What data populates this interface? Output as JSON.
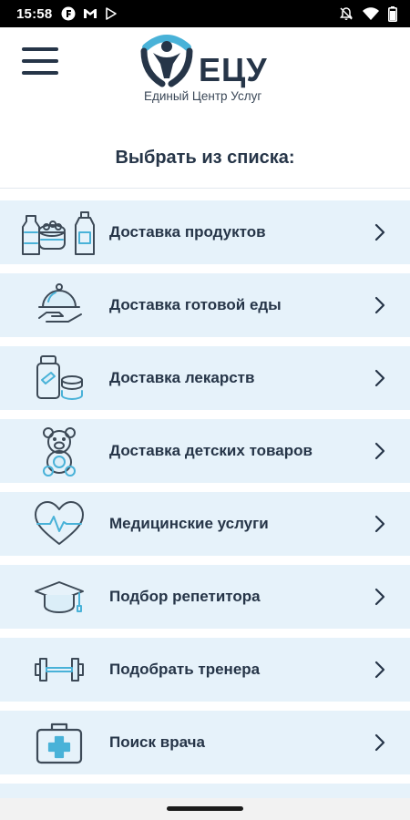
{
  "status_bar": {
    "time": "15:58",
    "left_icons": [
      "app-f-icon",
      "gmail-icon",
      "play-store-icon"
    ],
    "right_icons": [
      "muted-icon",
      "wifi-icon",
      "battery-icon"
    ]
  },
  "header": {
    "menu_icon": "hamburger-menu-icon",
    "logo_text": "ЕЦУ",
    "logo_subtitle": "Единый Центр Услуг"
  },
  "section": {
    "title": "Выбрать из списка:"
  },
  "services": [
    {
      "label": "Доставка продуктов",
      "icon": "groceries-icon"
    },
    {
      "label": "Доставка готовой еды",
      "icon": "food-dish-icon"
    },
    {
      "label": "Доставка лекарств",
      "icon": "medicine-icon"
    },
    {
      "label": "Доставка детских товаров",
      "icon": "teddy-bear-icon"
    },
    {
      "label": "Медицинские услуги",
      "icon": "heart-pulse-icon"
    },
    {
      "label": "Подбор репетитора",
      "icon": "graduation-cap-icon"
    },
    {
      "label": "Подобрать тренера",
      "icon": "dumbbell-icon"
    },
    {
      "label": "Поиск врача",
      "icon": "first-aid-kit-icon"
    }
  ],
  "colors": {
    "primary_text": "#263548",
    "icon_stroke": "#3d4a57",
    "icon_accent": "#49b2d8",
    "row_background": "#e6f2fa"
  }
}
